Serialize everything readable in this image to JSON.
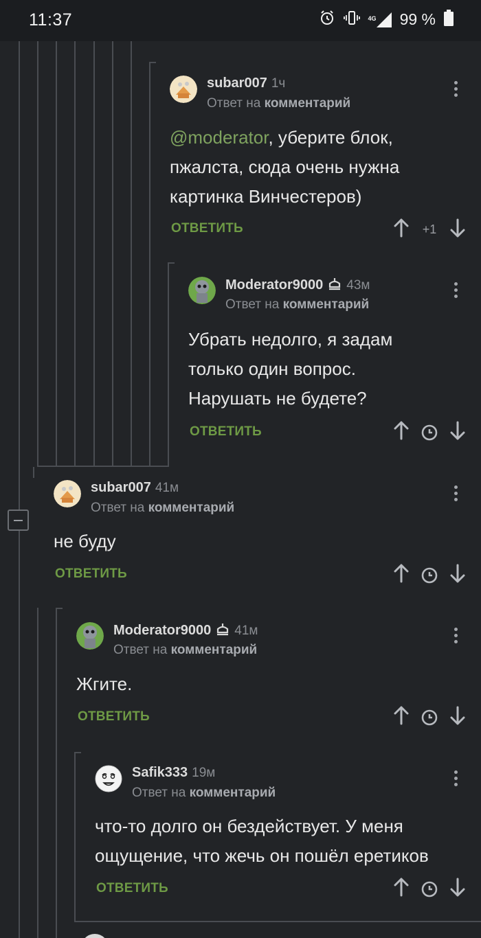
{
  "status_bar": {
    "time": "11:37",
    "network": "4G",
    "battery": "99 %"
  },
  "comments": [
    {
      "user": "subar007",
      "time": "1ч",
      "reply_prefix": "Ответ на",
      "reply_target": "комментарий",
      "mention": "@moderator",
      "text_line1_rest": ", уберите блок,",
      "text_line2": "пжалста, сюда очень нужна",
      "text_line3": "картинка Винчестеров)",
      "answer_label": "ОТВЕТИТЬ",
      "rating": "+1"
    },
    {
      "user": "Moderator9000",
      "time": "43м",
      "reply_prefix": "Ответ на",
      "reply_target": "комментарий",
      "text_line1": "Убрать недолго, я задам",
      "text_line2": "только один вопрос.",
      "text_line3": "Нарушать не будете?",
      "answer_label": "ОТВЕТИТЬ"
    },
    {
      "user": "subar007",
      "time": "41м",
      "reply_prefix": "Ответ на",
      "reply_target": "комментарий",
      "text_line1": "не буду",
      "answer_label": "ОТВЕТИТЬ"
    },
    {
      "user": "Moderator9000",
      "time": "41м",
      "reply_prefix": "Ответ на",
      "reply_target": "комментарий",
      "text_line1": "Жгите.",
      "answer_label": "ОТВЕТИТЬ"
    },
    {
      "user": "Safik333",
      "time": "19м",
      "reply_prefix": "Ответ на",
      "reply_target": "комментарий",
      "text_line1": "что-то долго он бездействует. У меня",
      "text_line2": "ощущение, что жечь он пошёл еретиков",
      "answer_label": "ОТВЕТИТЬ"
    }
  ],
  "colors": {
    "background": "#222427",
    "accent_green": "#6e9a45",
    "tree_line": "#4a4d52"
  }
}
